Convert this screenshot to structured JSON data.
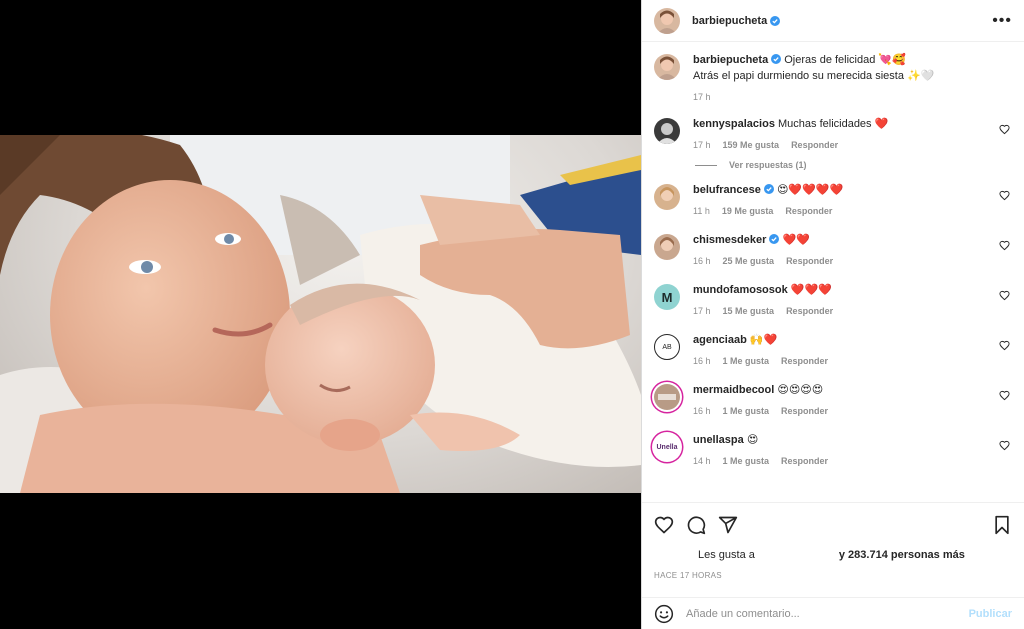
{
  "post": {
    "author": "barbiepucheta",
    "caption_line1": "Ojeras de felicidad 💘🥰",
    "caption_line2": "Atrás el papi durmiendo su merecida siesta ✨🤍",
    "caption_time": "17 h"
  },
  "comments": [
    {
      "user": "kennyspalacios",
      "text": "Muchas felicidades ❤️",
      "time": "17 h",
      "likes": "159 Me gusta",
      "reply": "Responder",
      "avatar_color": "#3a3a3a",
      "avatar_letter": ""
    },
    {
      "user": "belufrancese",
      "text": "😍❤️❤️❤️❤️",
      "time": "11 h",
      "likes": "19 Me gusta",
      "reply": "Responder",
      "avatar_color": "#d7b28e",
      "avatar_letter": "",
      "verified": true
    },
    {
      "user": "chismesdeker",
      "text": "❤️❤️",
      "time": "16 h",
      "likes": "25 Me gusta",
      "reply": "Responder",
      "avatar_color": "#c9a78f",
      "avatar_letter": "",
      "verified": true
    },
    {
      "user": "mundofamososok",
      "text": "❤️❤️❤️",
      "time": "17 h",
      "likes": "15 Me gusta",
      "reply": "Responder",
      "avatar_color": "#8fd3d1",
      "avatar_letter": "M"
    },
    {
      "user": "agenciaab",
      "text": "🙌❤️",
      "time": "16 h",
      "likes": "1 Me gusta",
      "reply": "Responder",
      "avatar_color": "#ffffff",
      "avatar_letter": "AB"
    },
    {
      "user": "mermaidbecool",
      "text": "😍😍😍😍",
      "time": "16 h",
      "likes": "1 Me gusta",
      "reply": "Responder",
      "avatar_color": "#b89b86",
      "avatar_letter": ""
    },
    {
      "user": "unellaspa",
      "text": "😍",
      "time": "14 h",
      "likes": "1 Me gusta",
      "reply": "Responder",
      "avatar_color": "#ffffff",
      "avatar_letter": "Unella"
    }
  ],
  "view_replies": "Ver respuestas (1)",
  "likes_prefix": "Les gusta a",
  "likes_suffix": "y 283.714 personas más",
  "time_ago": "HACE 17 HORAS",
  "add_comment": {
    "placeholder": "Añade un comentario...",
    "publish": "Publicar"
  },
  "colors": {
    "verified": "#3897f0",
    "heart": "#ed4956",
    "publish": "#b2dffc"
  }
}
